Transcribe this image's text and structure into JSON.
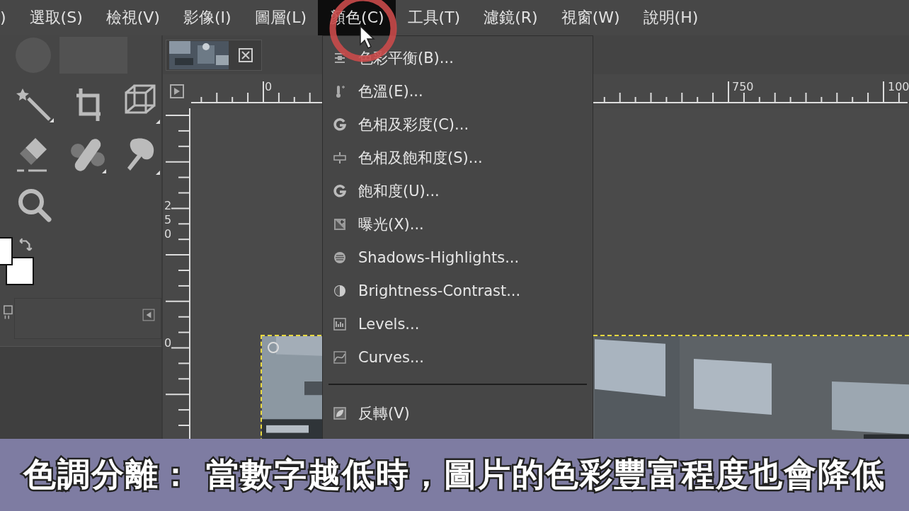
{
  "menubar": [
    {
      "label": ")",
      "selected": false
    },
    {
      "label": "選取(S)",
      "selected": false
    },
    {
      "label": "檢視(V)",
      "selected": false
    },
    {
      "label": "影像(I)",
      "selected": false
    },
    {
      "label": "圖層(L)",
      "selected": false
    },
    {
      "label": "顏色(C)",
      "selected": true
    },
    {
      "label": "工具(T)",
      "selected": false
    },
    {
      "label": "濾鏡(R)",
      "selected": false
    },
    {
      "label": "視窗(W)",
      "selected": false
    },
    {
      "label": "說明(H)",
      "selected": false
    }
  ],
  "rulers": {
    "horizontal": [
      "0",
      "750",
      "100"
    ],
    "vertical": [
      "250",
      "0"
    ]
  },
  "color_menu": [
    {
      "kind": "item",
      "label": "色彩平衡(B)..."
    },
    {
      "kind": "item",
      "label": "色溫(E)..."
    },
    {
      "kind": "item",
      "label": "色相及彩度(C)..."
    },
    {
      "kind": "item",
      "label": "色相及飽和度(S)..."
    },
    {
      "kind": "item",
      "label": "飽和度(U)..."
    },
    {
      "kind": "item",
      "label": "曝光(X)..."
    },
    {
      "kind": "item",
      "label": "Shadows-Highlights..."
    },
    {
      "kind": "item",
      "label": "Brightness-Contrast..."
    },
    {
      "kind": "item",
      "label": "Levels..."
    },
    {
      "kind": "item",
      "label": "Curves..."
    },
    {
      "kind": "separator"
    },
    {
      "kind": "item",
      "label": "反轉(V)"
    }
  ],
  "caption": "色調分離： 當數字越低時，圖片的色彩豐富程度也會降低"
}
